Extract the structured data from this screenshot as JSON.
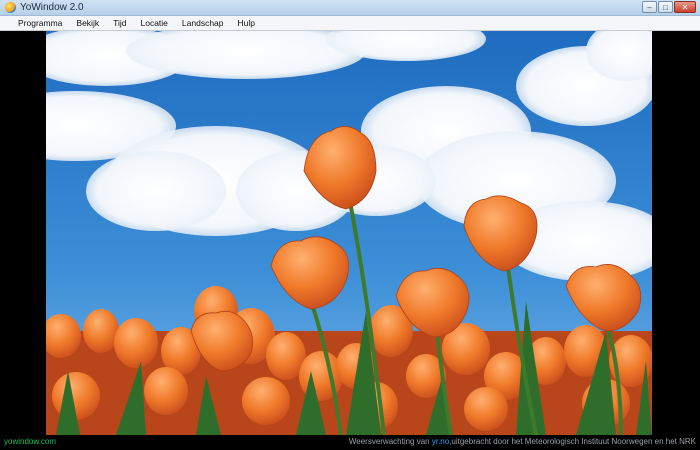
{
  "window": {
    "title": "YoWindow 2.0",
    "controls": {
      "minimize": "–",
      "maximize": "□",
      "close": "✕"
    }
  },
  "menu": {
    "items": [
      "Programma",
      "Bekijk",
      "Tijd",
      "Locatie",
      "Landschap",
      "Hulp"
    ]
  },
  "scene": {
    "landscape": "tulip-field",
    "sky_color": "#2f7cc8",
    "tulip_color": "#f07a2a"
  },
  "footer": {
    "brand_link": "yowindow.com",
    "credit_prefix": "Weersverwachting van ",
    "credit_link": "yr.no",
    "credit_suffix": ",uitgebracht door het Meteorologisch Instituut Noorwegen en het NRK"
  }
}
